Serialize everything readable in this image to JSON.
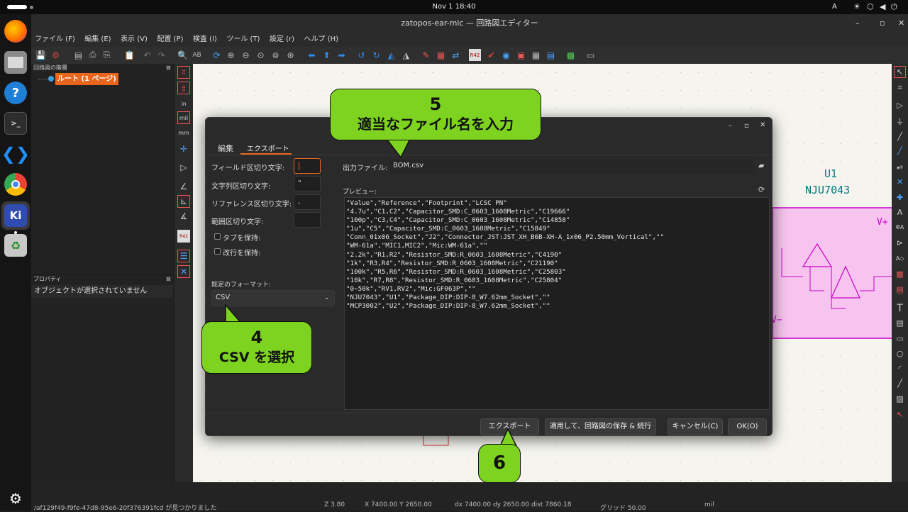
{
  "system": {
    "clock": "Nov 1  18:40",
    "input_indicator": "A"
  },
  "window": {
    "title": "zatopos-ear-mic — 回路図エディター"
  },
  "menu": [
    "ファイル (F)",
    "編集 (E)",
    "表示 (V)",
    "配置 (P)",
    "検査 (I)",
    "ツール (T)",
    "設定 (r)",
    "ヘルプ (H)"
  ],
  "hierarchy": {
    "title": "回路図の階層",
    "root_label": "ルート (1 ページ)"
  },
  "properties": {
    "title": "プロパティ",
    "empty_text": "オブジェクトが選択されていません"
  },
  "canvas": {
    "ref": "U1",
    "value": "NJU7043",
    "vplus": "V+",
    "vminus": "V−"
  },
  "dialog": {
    "tabs": [
      "編集",
      "エクスポート"
    ],
    "active_tab": "エクスポート",
    "field_sep_label": "フィールド区切り文字:",
    "field_sep_value": "",
    "string_sep_label": "文字列区切り文字:",
    "string_sep_value": "\"",
    "ref_sep_label": "リファレンス区切り文字:",
    "ref_sep_value": ",",
    "range_sep_label": "範囲区切り文字:",
    "range_sep_value": "",
    "keep_tabs_label": "タブを保持:",
    "keep_newlines_label": "改行を保持:",
    "preset_label": "既定のフォーマット:",
    "preset_value": "CSV",
    "output_label": "出力ファイル:",
    "output_value": "BOM.csv",
    "preview_label": "プレビュー:",
    "preview_lines": [
      "\"Value\",\"Reference\",\"Footprint\",\"LCSC PN\"",
      "\"4.7u\",\"C1,C2\",\"Capacitor_SMD:C_0603_1608Metric\",\"C19666\"",
      "\"100p\",\"C3,C4\",\"Capacitor_SMD:C_0603_1608Metric\",\"C14858\"",
      "\"1u\",\"C5\",\"Capacitor_SMD:C_0603_1608Metric\",\"C15849\"",
      "\"Conn_01x06_Socket\",\"J2\",\"Connector_JST:JST_XH_B6B-XH-A_1x06_P2.50mm_Vertical\",\"\"",
      "\"WM-61a\",\"MIC1,MIC2\",\"Mic:WM-61a\",\"\"",
      "\"2.2k\",\"R1,R2\",\"Resistor_SMD:R_0603_1608Metric\",\"C4190\"",
      "\"1k\",\"R3,R4\",\"Resistor_SMD:R_0603_1608Metric\",\"C21190\"",
      "\"100k\",\"R5,R6\",\"Resistor_SMD:R_0603_1608Metric\",\"C25803\"",
      "\"10k\",\"R7,R8\",\"Resistor_SMD:R_0603_1608Metric\",\"C25804\"",
      "\"0~50k\",\"RV1,RV2\",\"Mic:GF063P\",\"\"",
      "\"NJU7043\",\"U1\",\"Package_DIP:DIP-8_W7.62mm_Socket\",\"\"",
      "\"MCP3002\",\"U2\",\"Package_DIP:DIP-8_W7.62mm_Socket\",\"\""
    ],
    "buttons": {
      "export": "エクスポート",
      "apply": "適用して、回路図の保存 & 続行",
      "cancel": "キャンセル(C)",
      "ok": "OK(O)"
    }
  },
  "callouts": {
    "c5_num": "5",
    "c5_text": "適当なファイル名を入力",
    "c4_num": "4",
    "c4_text": "CSV を選択",
    "c6_num": "6"
  },
  "status": {
    "message": "/af129f49-f9fe-47d8-95e6-20f376391fcd が見つかりました",
    "zoom": "Z 3.80",
    "xy": "X 7400.00  Y 2650.00",
    "delta": "dx 7400.00  dy 2650.00  dist 7860.18",
    "grid": "グリッド 50.00",
    "units": "mil"
  },
  "colors": {
    "accent": "#e8651d",
    "callout": "#7ed321",
    "symbol_fill": "#f7c4ef",
    "symbol_stroke": "#c800c8",
    "label_teal": "#00787c"
  }
}
